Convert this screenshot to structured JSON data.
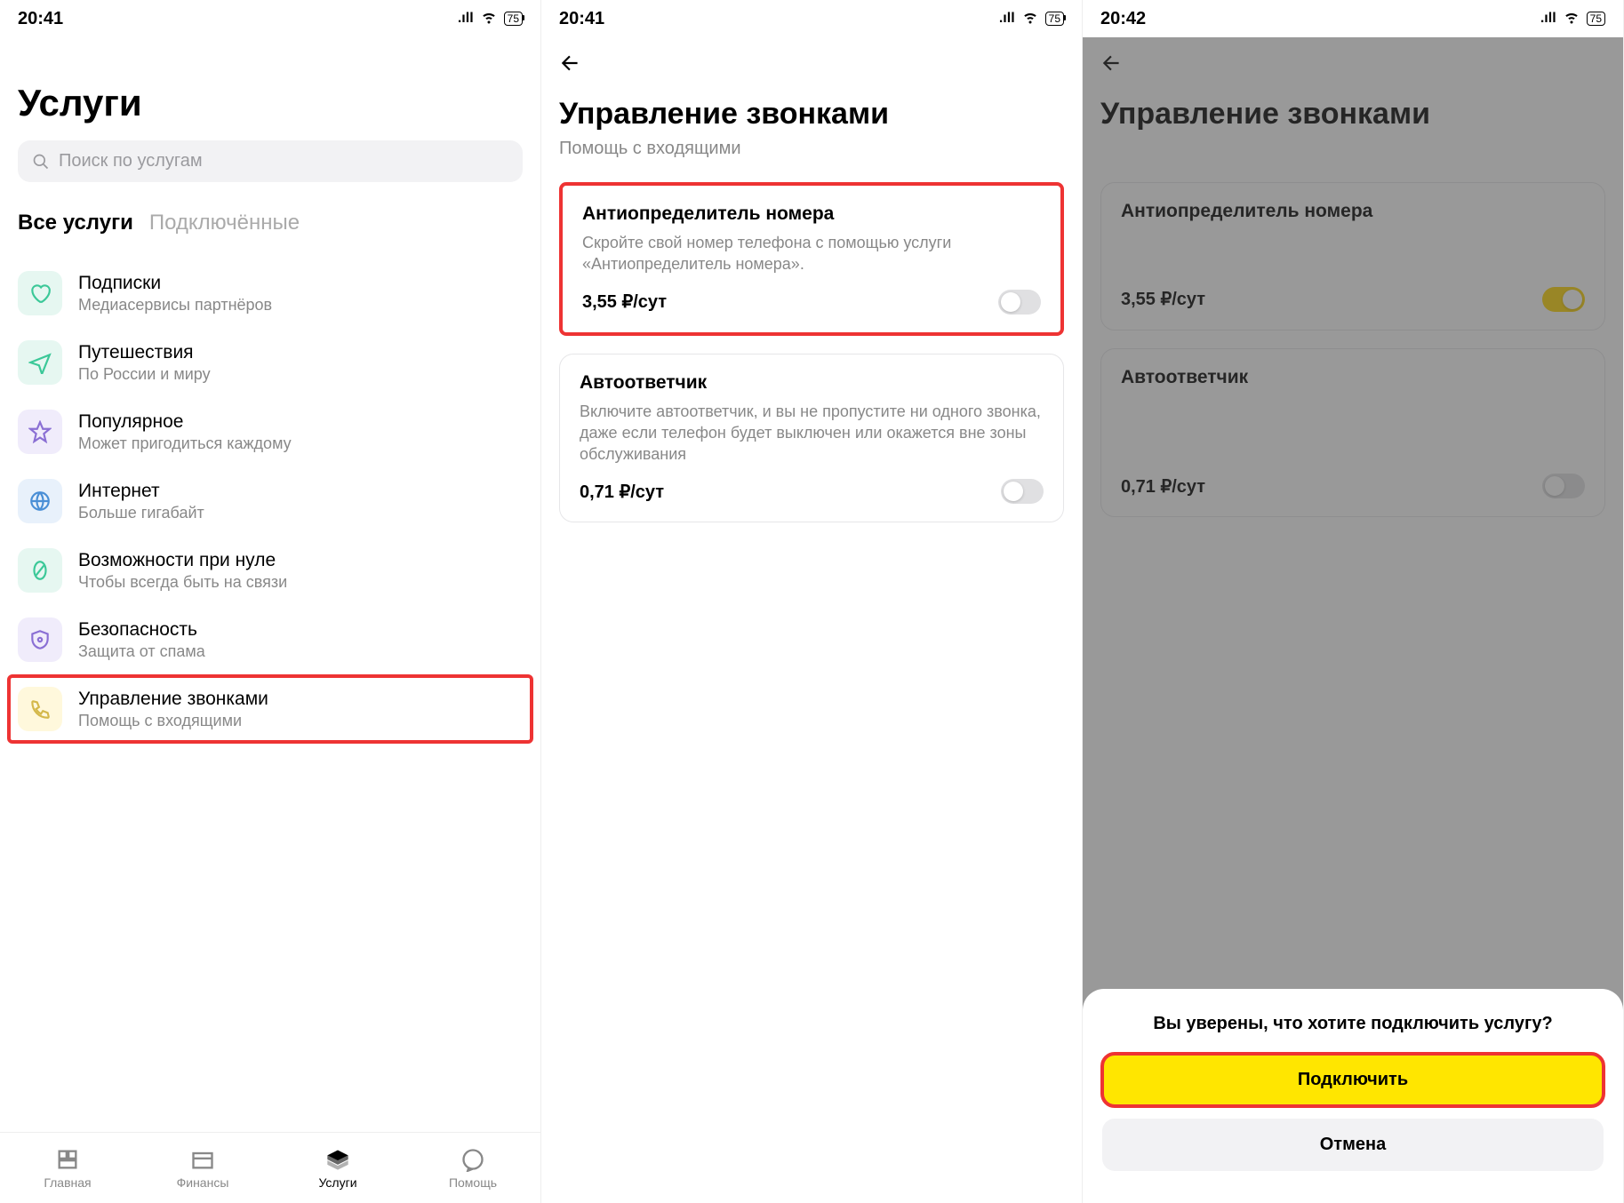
{
  "status": {
    "time1": "20:41",
    "time2": "20:41",
    "time3": "20:42",
    "battery": "75"
  },
  "screen1": {
    "title": "Услуги",
    "search_placeholder": "Поиск по услугам",
    "tabs": {
      "all": "Все услуги",
      "connected": "Подключённые"
    },
    "items": [
      {
        "title": "Подписки",
        "sub": "Медиасервисы партнёров"
      },
      {
        "title": "Путешествия",
        "sub": "По России и миру"
      },
      {
        "title": "Популярное",
        "sub": "Может пригодиться каждому"
      },
      {
        "title": "Интернет",
        "sub": "Больше гигабайт"
      },
      {
        "title": "Возможности при нуле",
        "sub": "Чтобы всегда быть на связи"
      },
      {
        "title": "Безопасность",
        "sub": "Защита от спама"
      },
      {
        "title": "Управление звонками",
        "sub": "Помощь с входящими"
      }
    ],
    "nav": {
      "home": "Главная",
      "finance": "Финансы",
      "services": "Услуги",
      "help": "Помощь"
    }
  },
  "screen2": {
    "title": "Управление звонками",
    "sub": "Помощь с входящими",
    "card1": {
      "title": "Антиопределитель номера",
      "desc": "Скройте свой номер телефона с помощью услуги «Антиопределитель номера».",
      "price": "3,55 ₽/сут"
    },
    "card2": {
      "title": "Автоответчик",
      "desc": "Включите автоответчик, и вы не пропустите ни одного звонка, даже если телефон будет выключен или окажется вне зоны обслуживания",
      "price": "0,71 ₽/сут"
    }
  },
  "screen3": {
    "sheet_title": "Вы уверены, что хотите подключить услугу?",
    "confirm": "Подключить",
    "cancel": "Отмена"
  }
}
